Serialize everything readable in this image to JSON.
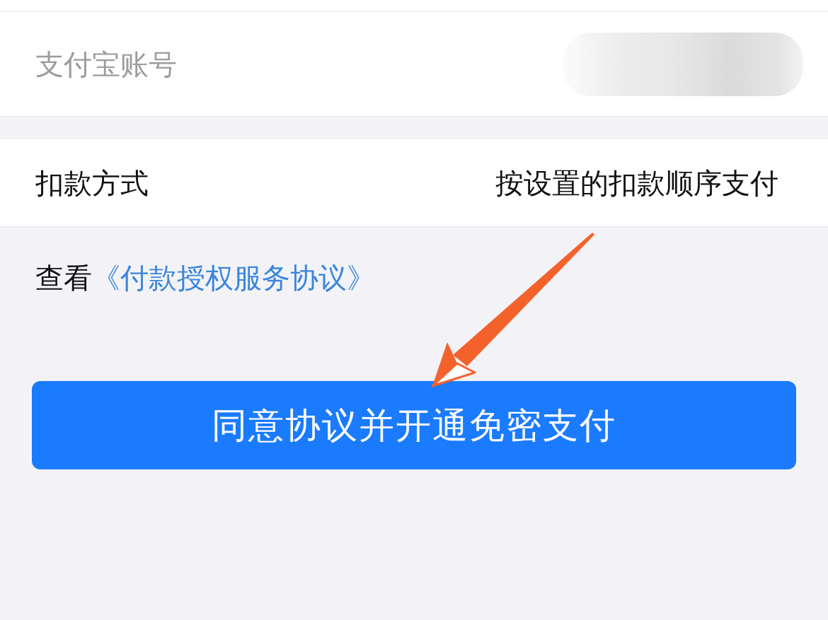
{
  "account_row": {
    "label": "支付宝账号",
    "value_blurred": true
  },
  "deduction_row": {
    "label": "扣款方式",
    "value": "按设置的扣款顺序支付"
  },
  "agreement": {
    "prefix": "查看",
    "link": "《付款授权服务协议》"
  },
  "confirm_button": {
    "label": "同意协议并开通免密支付"
  },
  "annotation": {
    "arrow": true
  }
}
